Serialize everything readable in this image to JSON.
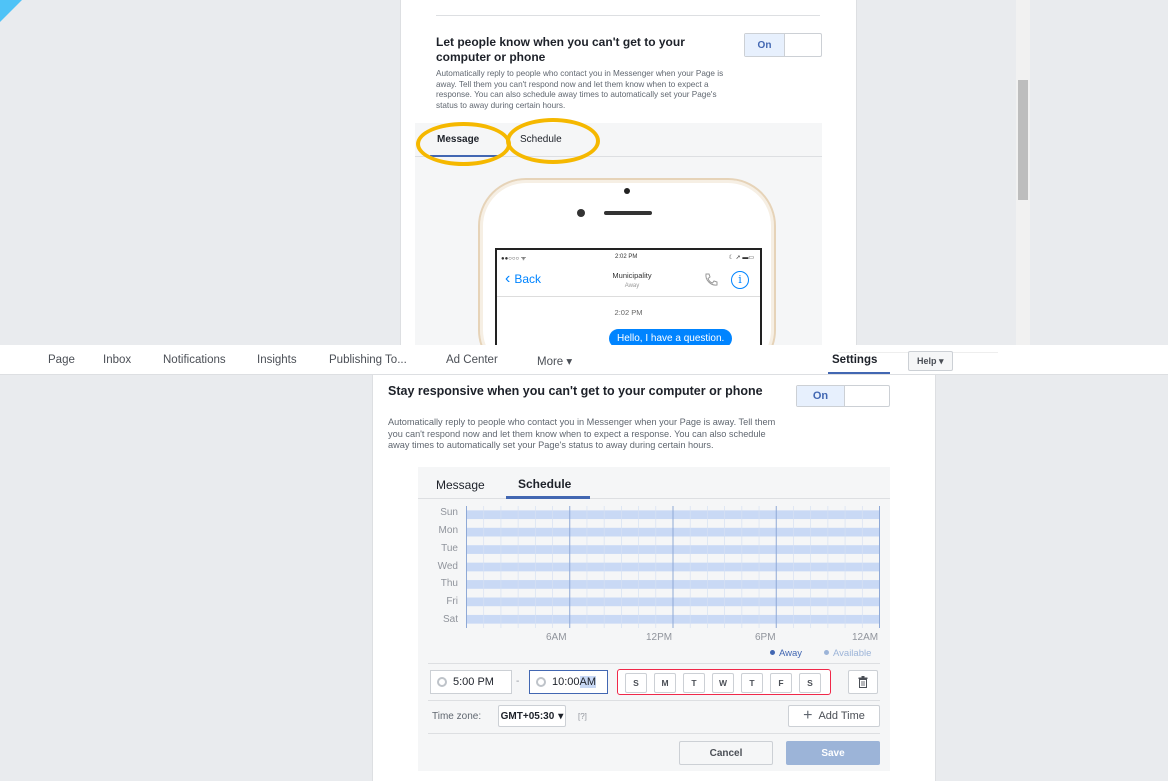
{
  "top": {
    "title": "Let people know when you can't get to your computer or phone",
    "description": "Automatically reply to people who contact you in Messenger when your Page is away. Tell them you can't respond now and let them know when to expect a response. You can also schedule away times to automatically set your Page's status to away during certain hours.",
    "toggle_label": "On",
    "tabs": [
      "Message",
      "Schedule"
    ],
    "highlight_color": "#f5b800",
    "phone": {
      "signal": "●●○○○ ᯤ",
      "status_time": "2:02 PM",
      "status_icons": "☾ ➚ ▬▭",
      "back_label": "Back",
      "contact_name": "Municipality",
      "contact_status": "Away",
      "message_time": "2:02 PM",
      "message": "Hello, I have a question."
    }
  },
  "nav": {
    "items": [
      "Page",
      "Inbox",
      "Notifications",
      "Insights",
      "Publishing To...",
      "Ad Center",
      "More ▾"
    ],
    "settings": "Settings",
    "help": "Help ▾"
  },
  "bottom": {
    "title": "Stay responsive when you can't get to your computer or phone",
    "description": "Automatically reply to people who contact you in Messenger when your Page is away. Tell them you can't respond now and let them know when to expect a response. You can also schedule away times to automatically set your Page's status to away during certain hours.",
    "toggle_label": "On",
    "tabs": [
      "Message",
      "Schedule"
    ],
    "active_tab": "Schedule",
    "schedule": {
      "days": [
        "Sun",
        "Mon",
        "Tue",
        "Wed",
        "Thu",
        "Fri",
        "Sat"
      ],
      "hour_labels": [
        "6AM",
        "12PM",
        "6PM",
        "12AM"
      ],
      "legend_away": "Away",
      "legend_available": "Available",
      "away_color": "#4267b2",
      "available_color": "#c9d9f5"
    },
    "time_start": "5:00 PM",
    "time_separator": "-",
    "time_end_hour": "10:00",
    "time_end_period": "AM",
    "weekday_buttons": [
      "S",
      "M",
      "T",
      "W",
      "T",
      "F",
      "S"
    ],
    "timezone_label": "Time zone:",
    "timezone_value": "GMT+05:30",
    "timezone_help": "[?]",
    "add_time_label": "Add Time",
    "cancel_label": "Cancel",
    "save_label": "Save"
  }
}
